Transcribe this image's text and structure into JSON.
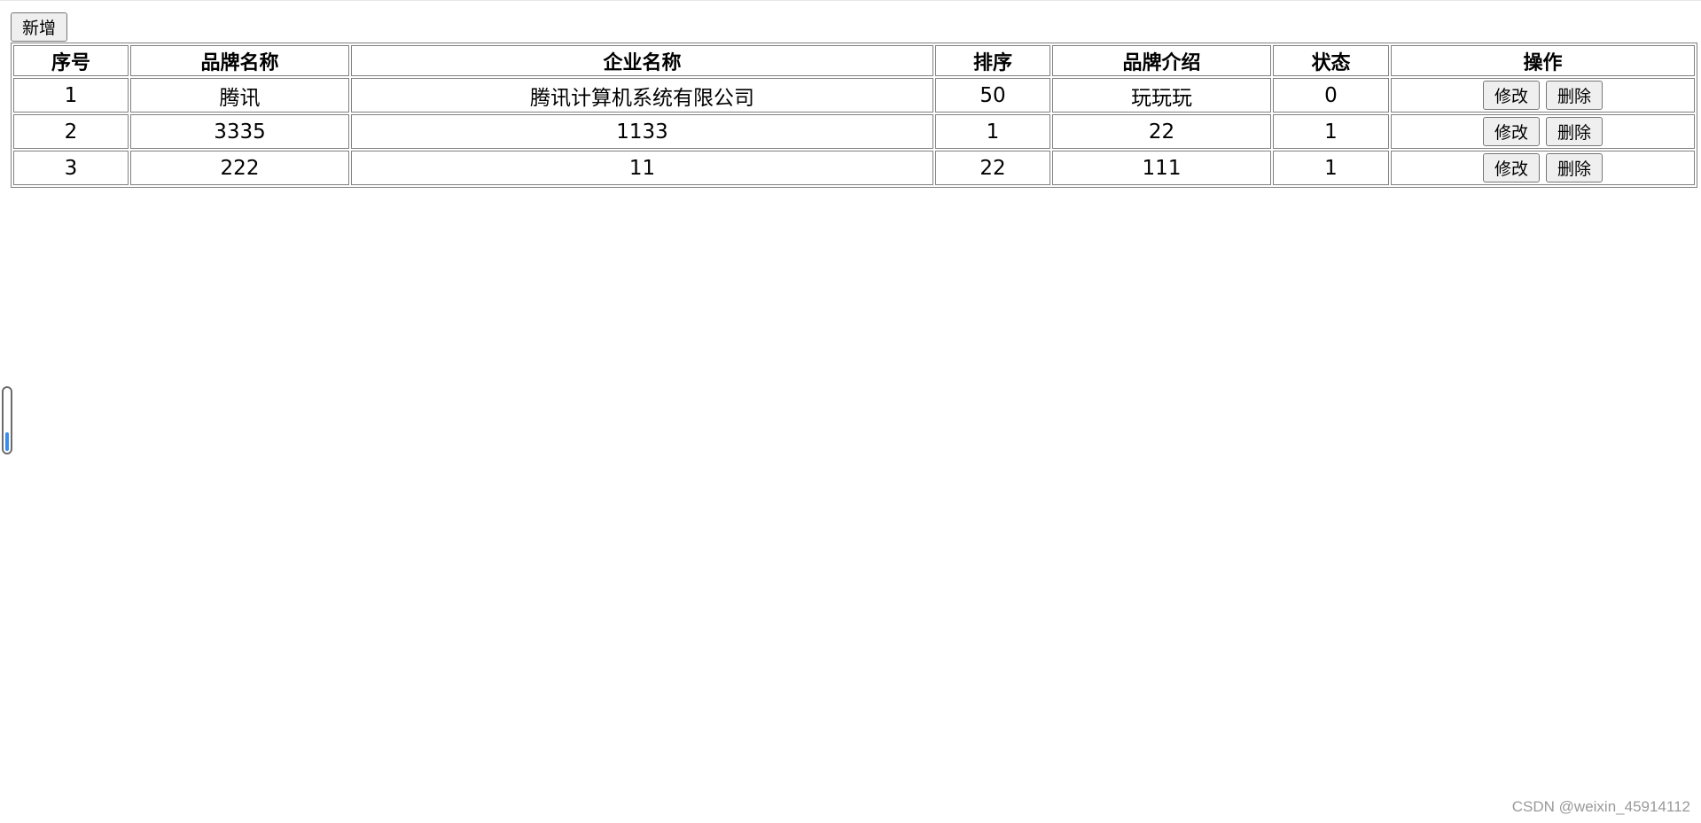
{
  "toolbar": {
    "add_label": "新增"
  },
  "table": {
    "headers": [
      "序号",
      "品牌名称",
      "企业名称",
      "排序",
      "品牌介绍",
      "状态",
      "操作"
    ],
    "rows": [
      {
        "index": "1",
        "brand_name": "腾讯",
        "company_name": "腾讯计算机系统有限公司",
        "ordered": "50",
        "description": "玩玩玩",
        "status": "0"
      },
      {
        "index": "2",
        "brand_name": "3335",
        "company_name": "1133",
        "ordered": "1",
        "description": "22",
        "status": "1"
      },
      {
        "index": "3",
        "brand_name": "222",
        "company_name": "11",
        "ordered": "22",
        "description": "111",
        "status": "1"
      }
    ],
    "edit_label": "修改",
    "delete_label": "删除"
  },
  "progress": {
    "value": 0.3,
    "fill_color": "#3b8cf0"
  },
  "watermark": {
    "text": "CSDN @weixin_45914112"
  }
}
